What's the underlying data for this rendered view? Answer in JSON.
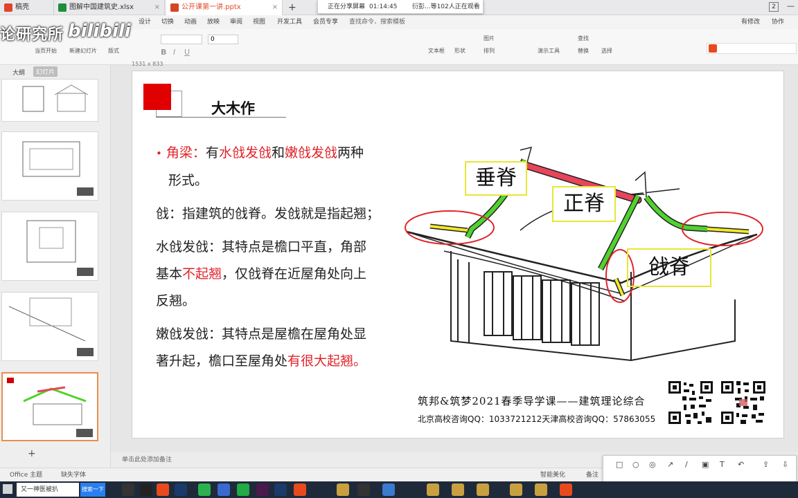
{
  "tabs": [
    {
      "label": "稿壳",
      "color": "#e0442a"
    },
    {
      "label": "图解中国建筑史.xlsx",
      "color": "#1e8e3e"
    },
    {
      "label": "公开课第一讲.pptx",
      "color": "#d24726",
      "active": true
    }
  ],
  "new_tab": "+",
  "share_bar": {
    "status": "正在分享屏幕",
    "time": "01:14:45",
    "viewers": "衍彭...等102人正在观看"
  },
  "window_controls": {
    "page": "2",
    "minimize": "—"
  },
  "watermark": {
    "left": "论研究所",
    "bili": "bilibili"
  },
  "ribbon_tabs": [
    "设计",
    "切换",
    "动画",
    "放映",
    "审阅",
    "视图",
    "开发工具",
    "会员专享"
  ],
  "ribbon_search": "查找命令、搜索模板",
  "ribbon_right": [
    "有修改",
    "协作"
  ],
  "ribbon_buttons": [
    "当页开始",
    "新建幻灯片",
    "版式",
    "文本框",
    "形状",
    "排列",
    "演示工具",
    "替换",
    "选择",
    "图片",
    "查找"
  ],
  "ribbon_font_size": "0",
  "panel_tabs": [
    "大纲",
    "幻灯片"
  ],
  "ruler_label": "1531 x 833",
  "slide": {
    "title": "大木作",
    "bullet_label": "角梁：",
    "bullet_text_1": "有",
    "bullet_red_1": "水戗发戗",
    "bullet_text_2": "和",
    "bullet_red_2": "嫩戗发戗",
    "bullet_text_3": "两种",
    "bullet_line2": "形式。",
    "p1": "戗：指建筑的戗脊。发戗就是指起翘；",
    "p2_line1": "水戗发戗：其特点是檐口平直，角部",
    "p2_line2a": "基本",
    "p2_red": "不起翘",
    "p2_line2b": "，仅戗脊在近屋角处向上",
    "p2_line3": "反翘。",
    "p3_line1": "嫩戗发戗：其特点是屋檐在屋角处显",
    "p3_line2a": "著升起，檐口至屋角处",
    "p3_red": "有很大起翘。",
    "labels": {
      "chuiji": "垂脊",
      "zhengji": "正脊",
      "qiangji": "戗脊"
    },
    "footer_line1": "筑邦&筑梦2021春季导学课——建筑理论综合",
    "footer_line2": "北京高校咨询QQ：1033721212天津高校咨询QQ：57863055"
  },
  "status": {
    "notes": "单击此处添加备注",
    "theme": "Office 主题",
    "missing_font": "缺失字体",
    "smart": "智能美化",
    "remarks": "备注"
  },
  "draw_tools": [
    "□",
    "○",
    "◎",
    "↗",
    "/",
    "▣",
    "T",
    "↶",
    "⇪",
    "⇩"
  ],
  "swatch_colors": [
    "#e03030",
    "#f2a21a",
    "#2a8ef0",
    "#22aa44",
    "#1b7a2a",
    "#555555"
  ],
  "taskbar": {
    "search": "又一神医被扒",
    "search_button": "搜索一下"
  },
  "colors": {
    "accent": "#e0242a",
    "label_border": "#e6e635",
    "ridge_red": "#e8455a",
    "ridge_green": "#4fd32e"
  }
}
